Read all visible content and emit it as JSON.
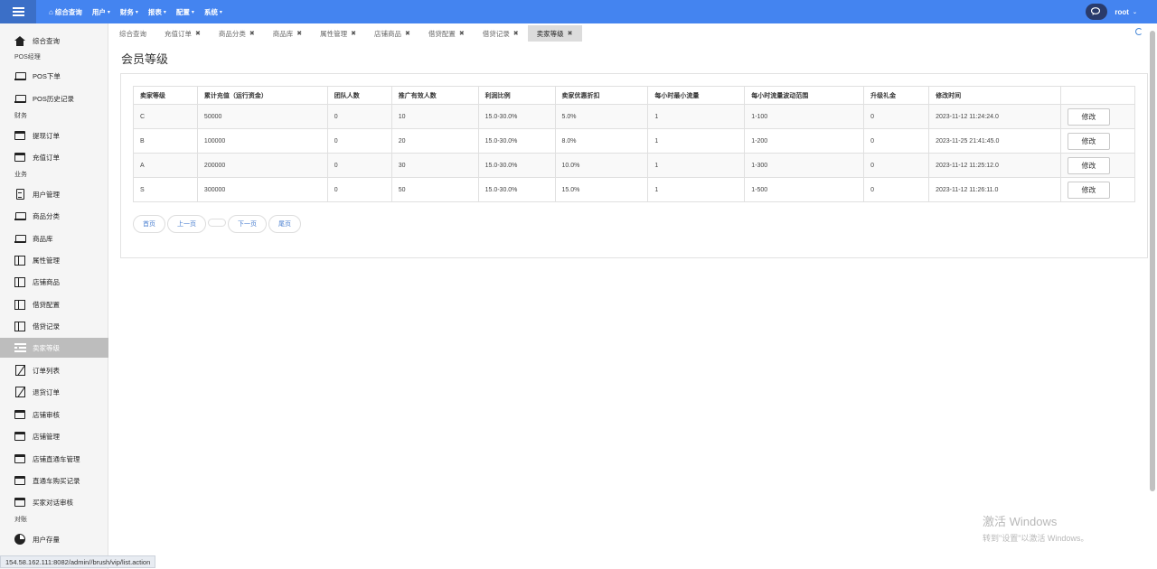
{
  "topbar": {
    "nav": [
      {
        "label": "综合查询",
        "icon": "home-icon",
        "caret": false
      },
      {
        "label": "用户",
        "caret": true
      },
      {
        "label": "财务",
        "caret": true
      },
      {
        "label": "报表",
        "caret": true
      },
      {
        "label": "配置",
        "caret": true
      },
      {
        "label": "系统",
        "caret": true
      }
    ],
    "username": "root"
  },
  "sidebar": {
    "home": "综合查询",
    "sections": {
      "pos": "POS经理",
      "finance": "财务",
      "business": "业务",
      "reconcile": "对账"
    },
    "items": [
      "POS下单",
      "POS历史记录",
      "提现订单",
      "充值订单",
      "用户管理",
      "商品分类",
      "商品库",
      "属性管理",
      "店铺商品",
      "借贷配置",
      "借贷记录",
      "卖家等级",
      "订单列表",
      "退货订单",
      "店铺审核",
      "店铺管理",
      "店铺直通车管理",
      "直通车购买记录",
      "买家对话审核",
      "用户存量"
    ]
  },
  "tabs": [
    {
      "label": "综合查询",
      "closable": false,
      "active": false
    },
    {
      "label": "充值订单",
      "closable": true,
      "active": false
    },
    {
      "label": "商品分类",
      "closable": true,
      "active": false
    },
    {
      "label": "商品库",
      "closable": true,
      "active": false
    },
    {
      "label": "属性管理",
      "closable": true,
      "active": false
    },
    {
      "label": "店铺商品",
      "closable": true,
      "active": false
    },
    {
      "label": "借贷配置",
      "closable": true,
      "active": false
    },
    {
      "label": "借贷记录",
      "closable": true,
      "active": false
    },
    {
      "label": "卖家等级",
      "closable": true,
      "active": true
    }
  ],
  "page_title": "会员等级",
  "table": {
    "headers": [
      "卖家等级",
      "累计充值（运行资金）",
      "团队人数",
      "推广有效人数",
      "利润比例",
      "卖家优惠折扣",
      "每小时最小流量",
      "每小时流量波动范围",
      "升级礼金",
      "修改时间",
      ""
    ],
    "rows": [
      [
        "C",
        "50000",
        "0",
        "10",
        "15.0-30.0%",
        "5.0%",
        "1",
        "1-100",
        "0",
        "2023-11-12 11:24:24.0"
      ],
      [
        "B",
        "100000",
        "0",
        "20",
        "15.0-30.0%",
        "8.0%",
        "1",
        "1-200",
        "0",
        "2023-11-25 21:41:45.0"
      ],
      [
        "A",
        "200000",
        "0",
        "30",
        "15.0-30.0%",
        "10.0%",
        "1",
        "1-300",
        "0",
        "2023-11-12 11:25:12.0"
      ],
      [
        "S",
        "300000",
        "0",
        "50",
        "15.0-30.0%",
        "15.0%",
        "1",
        "1-500",
        "0",
        "2023-11-12 11:26:11.0"
      ]
    ],
    "edit_label": "修改"
  },
  "pager": {
    "first": "首页",
    "prev": "上一页",
    "next": "下一页",
    "last": "尾页"
  },
  "watermark": {
    "line1": "激活 Windows",
    "line2": "转到\"设置\"以激活 Windows。"
  },
  "status_url": "154.58.162.111:8082/admin//brush/vip/list.action",
  "colors": {
    "topbar": "#4484f0",
    "active_sidebar": "#bdbdbd",
    "link": "#4a7fd0"
  }
}
